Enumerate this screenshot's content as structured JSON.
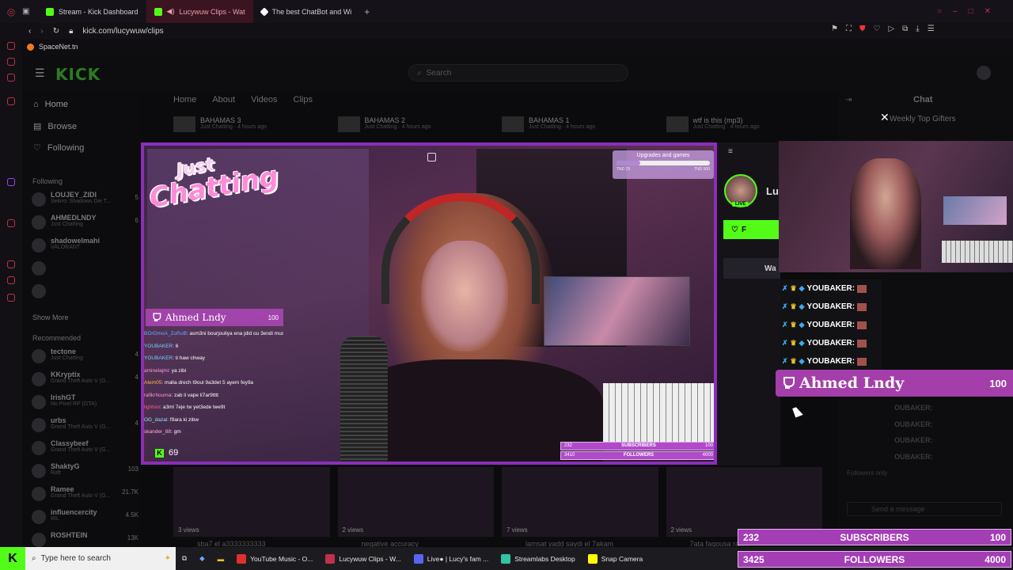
{
  "browser": {
    "tabs": [
      {
        "label": "Stream - Kick Dashboard",
        "active": false,
        "color": "#53fc18"
      },
      {
        "label": "Lucywuw Clips - Wat",
        "active": true,
        "color": "#53fc18"
      },
      {
        "label": "The best ChatBot and Wi",
        "active": false,
        "color": "#ffffff"
      }
    ],
    "new_tab": "+",
    "url": "kick.com/lucywuw/clips",
    "bookmark": "SpaceNet.tn"
  },
  "kick": {
    "logo": "KICK",
    "search_placeholder": "Search",
    "nav": [
      "Home",
      "Browse",
      "Following"
    ],
    "following_heading": "Following",
    "following": [
      {
        "name": "LOUJEY_ZIDI",
        "game": "Sekiro: Shadows Die T...",
        "viewers": "5"
      },
      {
        "name": "AHMEDLNDY",
        "game": "Just Chatting",
        "viewers": "6"
      },
      {
        "name": "shadowelmahi",
        "game": "VALORANT",
        "viewers": ""
      },
      {
        "name": "",
        "game": "",
        "viewers": ""
      },
      {
        "name": "",
        "game": "",
        "viewers": ""
      }
    ],
    "show_more": "Show More",
    "recommended_heading": "Recommended",
    "recommended": [
      {
        "name": "tectone",
        "game": "Just Chatting",
        "viewers": "4"
      },
      {
        "name": "KKryptix",
        "game": "Grand Theft Auto V (G...",
        "viewers": "4"
      },
      {
        "name": "IrishGT",
        "game": "No Pixel RP (GTA)",
        "viewers": ""
      },
      {
        "name": "urbs",
        "game": "Grand Theft Auto V (G...",
        "viewers": "4"
      },
      {
        "name": "Classybeef",
        "game": "Grand Theft Auto V (G...",
        "viewers": ""
      },
      {
        "name": "ShaktyG",
        "game": "Raft",
        "viewers": "103"
      },
      {
        "name": "Ramee",
        "game": "Grand Theft Auto V (G...",
        "viewers": "21.7K"
      },
      {
        "name": "influencercity",
        "game": "IRL",
        "viewers": "4.5K"
      },
      {
        "name": "ROSHTEIN",
        "game": "",
        "viewers": "13K"
      }
    ],
    "profile_tabs": [
      "Home",
      "About",
      "Videos",
      "Clips"
    ],
    "clips_top": [
      {
        "title": "BAHAMAS 3",
        "meta": "Just Chatting · 4 hours ago"
      },
      {
        "title": "BAHAMAS 2",
        "meta": "Just Chatting · 4 hours ago"
      },
      {
        "title": "BAHAMAS 1",
        "meta": "Just Chatting · 4 hours ago"
      },
      {
        "title": "wtf is this (mp3)",
        "meta": "Just Chatting · 4 hours ago"
      }
    ],
    "clips_bottom": [
      {
        "views": "3 views",
        "title": "sba7 el a3333333333"
      },
      {
        "views": "2 views",
        "title": "negative accuracy"
      },
      {
        "views": "7 views",
        "title": "lamsat yadd saydi el 7akam"
      },
      {
        "views": "2 views",
        "title": "7ata faqousa rahi"
      }
    ],
    "chat_heading": "Chat",
    "weekly_top_gifters": "Weekly Top Gifters",
    "close": "✕",
    "channel_initial": "Lu",
    "live": "LIVE",
    "follow_letter": "F",
    "watch": "Wa"
  },
  "stream": {
    "just": "Just",
    "chatting": "Chatting",
    "goal_title": "Upgrades and games",
    "goal_mid": "650",
    "goal_left": "TND 25",
    "goal_right": "TND 500",
    "goal_progress": 0.25,
    "gifter_name": "Ahmed Lndy",
    "gifter_count": "100",
    "chat": [
      {
        "user": "BOrOmoA_ZoRoB",
        "msg": "asm3ni bourjouliya ena jdid ou 3endi music req :(",
        "color": "#6aa7ff"
      },
      {
        "user": "YOUBAKER",
        "msg": "6",
        "color": "#6ad3ff"
      },
      {
        "user": "YOUBAKER",
        "msg": "ti haw chway",
        "color": "#6ad3ff"
      },
      {
        "user": "aminelajmi",
        "msg": "ya zibi",
        "color": "#ff9ad8"
      },
      {
        "user": "Atem05",
        "msg": "malla drech t9oul 9a3det 5 ayem fey9a",
        "color": "#ffb34a"
      },
      {
        "user": "rafikrhouma",
        "msg": "zab li vape li7ar9tttt",
        "color": "#ff9ad8"
      },
      {
        "user": "lightsin",
        "msg": "a3ml 7eje tw yet3ede lwe9t",
        "color": "#ff5a8a"
      },
      {
        "user": "OG_dazai",
        "msg": "f9ara ki zibw",
        "color": "#9ae0ff"
      },
      {
        "user": "skander_88",
        "msg": "gm",
        "color": "#ffb0d8"
      }
    ],
    "kick_viewers": "69",
    "mini_subs": {
      "left": "232",
      "label": "SUBSCRIBERS",
      "right": "100"
    },
    "mini_followers": {
      "left": "3410",
      "label": "FOLLOWERS",
      "right": "4000"
    }
  },
  "overlay": {
    "youbaker": [
      "YOUBAKER:",
      "YOUBAKER:",
      "YOUBAKER:",
      "YOUBAKER:",
      "YOUBAKER:"
    ],
    "faded": [
      "OUBAKER:",
      "OUBAKER:",
      "OUBAKER:",
      "OUBAKER:"
    ],
    "gifter_name": "Ahmed Lndy",
    "gifter_count": "100",
    "subs": {
      "left": "232",
      "label": "SUBSCRIBERS",
      "right": "100"
    },
    "followers": {
      "left": "3425",
      "label": "FOLLOWERS",
      "right": "4000"
    },
    "followers_only": "Followers only",
    "send_message": "Send a message"
  },
  "taskbar": {
    "search_placeholder": "Type here to search",
    "items": [
      {
        "label": "YouTube Music - O...",
        "color": "#e02f2f"
      },
      {
        "label": "Lucywuw Clips - W...",
        "color": "#c0304a"
      },
      {
        "label": "Live● | Lucy's fam ...",
        "color": "#5865f2"
      },
      {
        "label": "Streamlabs Desktop",
        "color": "#31c3a2"
      },
      {
        "label": "Snap Camera",
        "color": "#fffc00"
      }
    ]
  }
}
